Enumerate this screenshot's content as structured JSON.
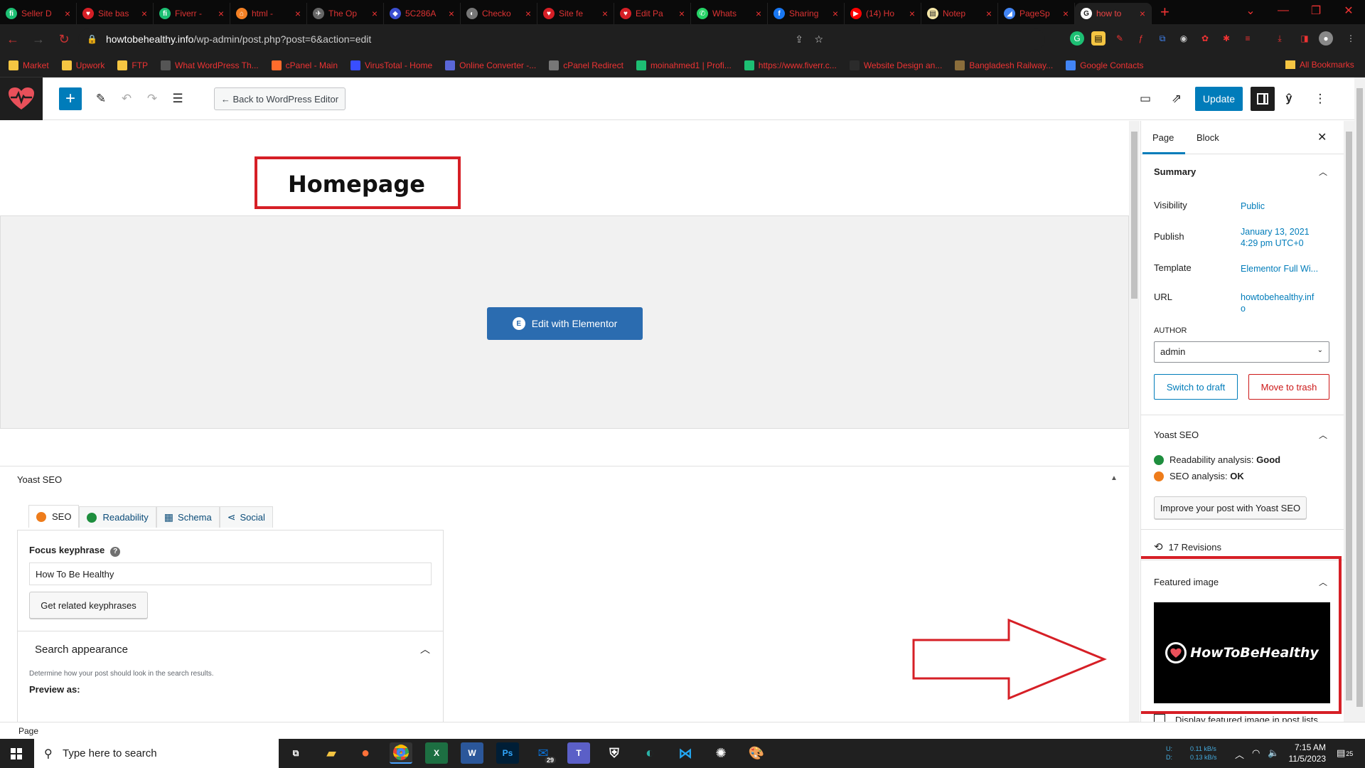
{
  "browser": {
    "tabs": [
      {
        "title": "Seller D",
        "fav": "fi",
        "color": "#1dbf73"
      },
      {
        "title": "Site bas",
        "fav": "♥",
        "color": "#d61f26"
      },
      {
        "title": "Fiverr -",
        "fav": "fi",
        "color": "#1dbf73"
      },
      {
        "title": "html - ",
        "fav": "⌂",
        "color": "#f48024"
      },
      {
        "title": "The Op",
        "fav": "✈",
        "color": "#666"
      },
      {
        "title": "5C286A",
        "fav": "◆",
        "color": "#3c4fd1"
      },
      {
        "title": "Checko",
        "fav": "◐",
        "color": "#777"
      },
      {
        "title": "Site fe",
        "fav": "♥",
        "color": "#d61f26"
      },
      {
        "title": "Edit Pa",
        "fav": "♥",
        "color": "#d61f26"
      },
      {
        "title": "Whats",
        "fav": "✆",
        "color": "#25d366"
      },
      {
        "title": "Sharing",
        "fav": "f",
        "color": "#1877f2"
      },
      {
        "title": "(14) Ho",
        "fav": "▶",
        "color": "#ff0000"
      },
      {
        "title": "Notep",
        "fav": "▤",
        "color": "#f5e6a8"
      },
      {
        "title": "PageSp",
        "fav": "◢",
        "color": "#4285f4"
      },
      {
        "title": "how to",
        "fav": "G",
        "color": "#ffffff"
      }
    ],
    "url_domain": "howtobehealthy.info",
    "url_path": "/wp-admin/post.php?post=6&action=edit",
    "bookmarks": [
      {
        "label": "Market",
        "color": "#f5c542"
      },
      {
        "label": "Upwork",
        "color": "#f5c542"
      },
      {
        "label": "FTP",
        "color": "#f5c542"
      },
      {
        "label": "What WordPress Th...",
        "color": "#555"
      },
      {
        "label": "cPanel - Main",
        "color": "#ff6c2c"
      },
      {
        "label": "VirusTotal - Home",
        "color": "#394eff"
      },
      {
        "label": "Online Converter -...",
        "color": "#5a67d8"
      },
      {
        "label": "cPanel Redirect",
        "color": "#777"
      },
      {
        "label": "moinahmed1 | Profi...",
        "color": "#1dbf73"
      },
      {
        "label": "https://www.fiverr.c...",
        "color": "#1dbf73"
      },
      {
        "label": "Website Design an...",
        "color": "#2b2b2b"
      },
      {
        "label": "Bangladesh Railway...",
        "color": "#8a6d3b"
      },
      {
        "label": "Google Contacts",
        "color": "#4285f4"
      }
    ],
    "all_bookmarks": "All Bookmarks"
  },
  "editor": {
    "back_label": "← Back to WordPress Editor",
    "update_label": "Update",
    "page_title": "Homepage",
    "elementor_label": "Edit with Elementor",
    "accent": "#007cba"
  },
  "yoast": {
    "heading": "Yoast SEO",
    "tabs": [
      {
        "label": "SEO",
        "icon": "orange"
      },
      {
        "label": "Readability",
        "icon": "green"
      },
      {
        "label": "Schema",
        "icon": "grid"
      },
      {
        "label": "Social",
        "icon": "share"
      }
    ],
    "focus_label": "Focus keyphrase",
    "focus_value": "How To Be Healthy",
    "related_label": "Get related keyphrases",
    "search_appearance": "Search appearance",
    "sa_desc": "Determine how your post should look in the search results.",
    "preview_as": "Preview as:"
  },
  "status": {
    "label": "Page"
  },
  "sidebar": {
    "tab_page": "Page",
    "tab_block": "Block",
    "summary": "Summary",
    "visibility_label": "Visibility",
    "visibility_value": "Public",
    "publish_label": "Publish",
    "publish_value_1": "January 13, 2021",
    "publish_value_2": "4:29 pm UTC+0",
    "template_label": "Template",
    "template_value": "Elementor Full Wi...",
    "url_label": "URL",
    "url_value_1": "howtobehealthy.inf",
    "url_value_2": "o",
    "author_label": "AUTHOR",
    "author_value": "admin",
    "draft_label": "Switch to draft",
    "trash_label": "Move to trash",
    "yoast_heading": "Yoast SEO",
    "readability_label": "Readability analysis:",
    "readability_value": "Good",
    "seo_label": "SEO analysis:",
    "seo_value": "OK",
    "improve_label": "Improve your post with Yoast SEO",
    "revisions": "17 Revisions",
    "featured_heading": "Featured image",
    "featured_text": "HowToBeHealthy",
    "display_label": "Display featured image in post lists"
  },
  "taskbar": {
    "search_placeholder": "Type here to search",
    "net_up": "0.11 kB/s",
    "net_down": "0.13 kB/s",
    "net_up_label": "U:",
    "net_down_label": "D:",
    "time": "7:15 AM",
    "date": "11/5/2023",
    "mail_badge": "29",
    "notif_badge": "25"
  }
}
